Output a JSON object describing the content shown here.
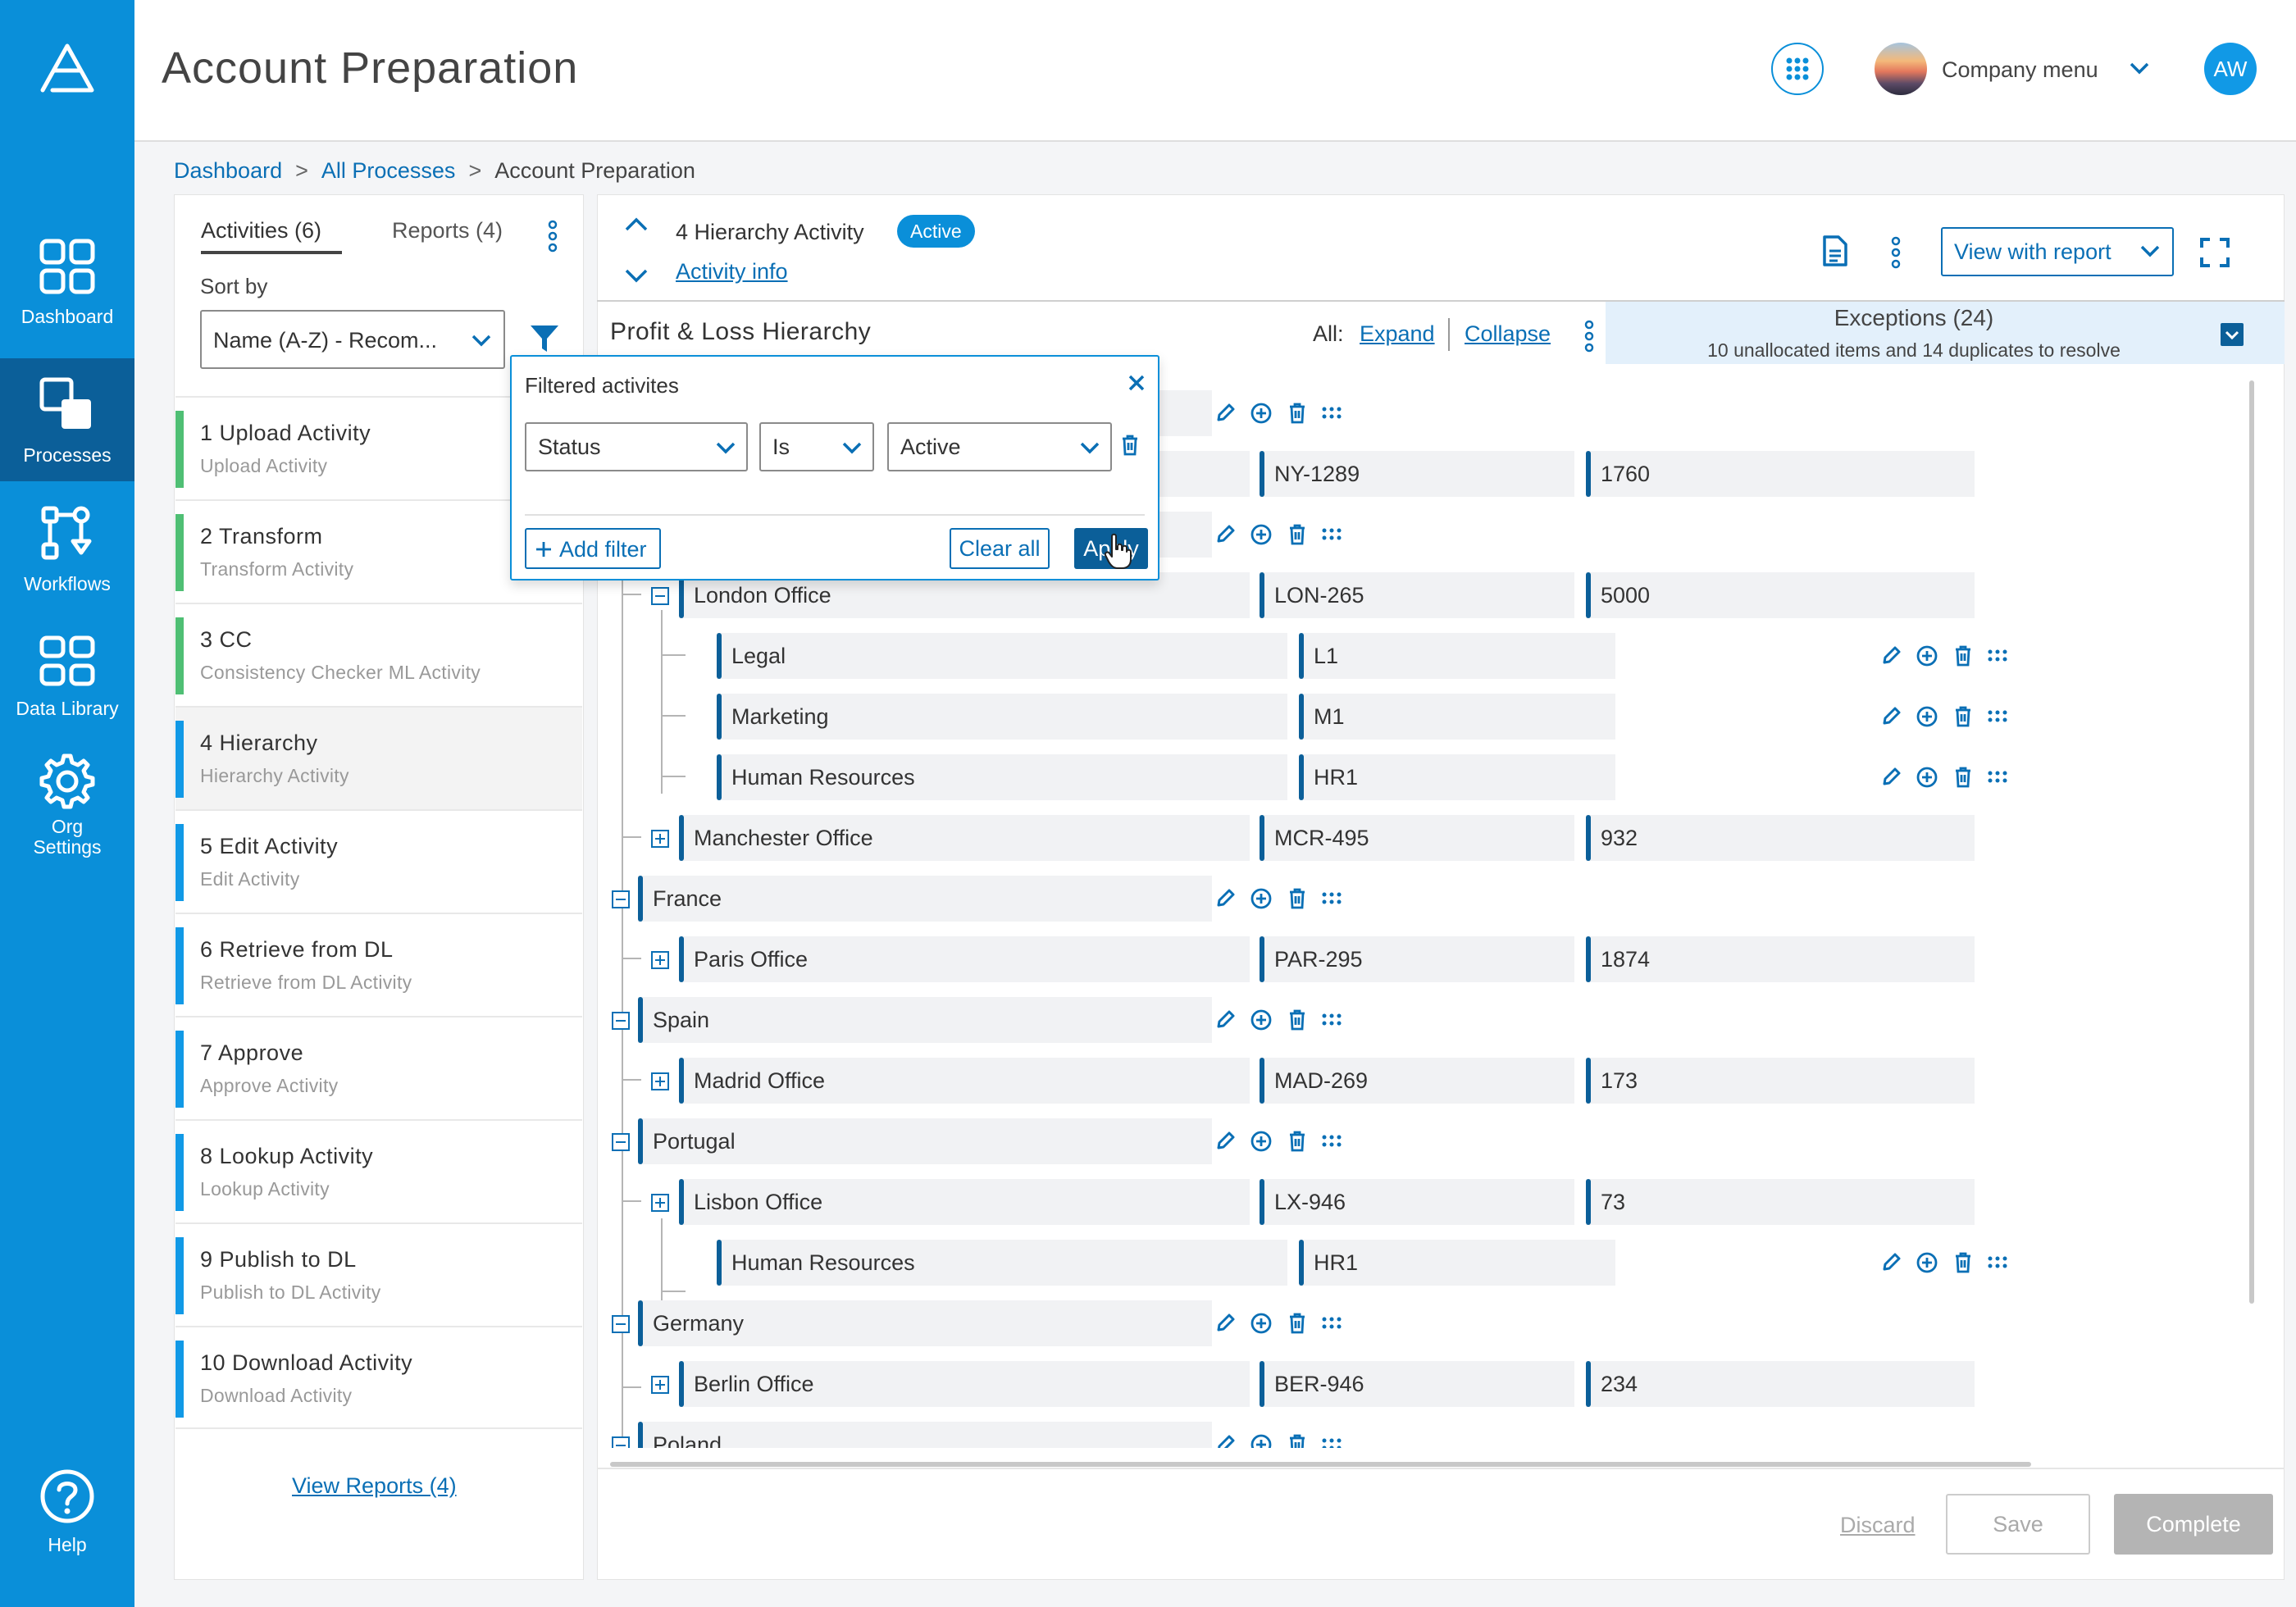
{
  "app": {
    "title": "Account Preparation"
  },
  "header": {
    "company_menu": "Company menu",
    "user_initials": "AW",
    "icons": [
      "apps-grid-icon",
      "chevron-down-icon"
    ]
  },
  "nav": {
    "items": [
      {
        "label": "Dashboard",
        "icon": "dashboard-icon"
      },
      {
        "label": "Processes",
        "icon": "processes-icon",
        "active": true
      },
      {
        "label": "Workflows",
        "icon": "workflows-icon"
      },
      {
        "label": "Data Library",
        "icon": "data-library-icon"
      },
      {
        "label": "Org",
        "label2": "Settings",
        "icon": "gear-icon"
      }
    ],
    "help": "Help"
  },
  "breadcrumb": {
    "items": [
      "Dashboard",
      "All Processes",
      "Account Preparation"
    ],
    "separator": ">"
  },
  "left_panel": {
    "tabs": [
      "Activities (6)",
      "Reports (4)"
    ],
    "sort_label": "Sort by",
    "sort_value": "Name (A-Z) - Recom...",
    "activities": [
      {
        "name": "1 Upload Activity",
        "sub": "Upload Activity",
        "color": "#4fbf74"
      },
      {
        "name": "2 Transform",
        "sub": "Transform Activity",
        "color": "#4fbf74"
      },
      {
        "name": "3 CC",
        "sub": "Consistency Checker ML Activity",
        "color": "#4fbf74"
      },
      {
        "name": "4 Hierarchy",
        "sub": "Hierarchy Activity",
        "color": "#1199e6"
      },
      {
        "name": "5 Edit Activity",
        "sub": "Edit Activity",
        "color": "#1199e6"
      },
      {
        "name": "6 Retrieve from DL",
        "sub": "Retrieve from DL Activity",
        "color": "#1199e6"
      },
      {
        "name": "7 Approve",
        "sub": "Approve Activity",
        "color": "#1199e6"
      },
      {
        "name": "8 Lookup Activity",
        "sub": "Lookup Activity",
        "color": "#1199e6"
      },
      {
        "name": "9 Publish to DL",
        "sub": "Publish to DL  Activity",
        "color": "#1199e6"
      },
      {
        "name": "10 Download Activity",
        "sub": "Download Activity",
        "color": "#1199e6"
      }
    ],
    "view_reports": "View Reports (4)"
  },
  "main": {
    "activity_title": "4 Hierarchy Activity",
    "status_badge": "Active",
    "activity_info": "Activity info",
    "view_with_report": "View with report",
    "hierarchy_title": "Profit & Loss Hierarchy",
    "all_label": "All:",
    "expand": "Expand",
    "collapse": "Collapse",
    "exceptions_title": "Exceptions (24)",
    "exceptions_sub": "10 unallocated items and 14 duplicates to resolve",
    "tree_rows": [
      {
        "name": "",
        "code": "NY-1289",
        "value": "1760"
      },
      {
        "name": "London Office",
        "code": "LON-265",
        "value": "5000"
      },
      {
        "name": "Legal",
        "code": "L1"
      },
      {
        "name": "Marketing",
        "code": "M1"
      },
      {
        "name": "Human Resources",
        "code": "HR1"
      },
      {
        "name": "Manchester Office",
        "code": "MCR-495",
        "value": "932"
      },
      {
        "name": "France"
      },
      {
        "name": "Paris Office",
        "code": "PAR-295",
        "value": "1874"
      },
      {
        "name": "Spain"
      },
      {
        "name": "Madrid Office",
        "code": "MAD-269",
        "value": "173"
      },
      {
        "name": "Portugal"
      },
      {
        "name": "Lisbon Office",
        "code": "LX-946",
        "value": "73"
      },
      {
        "name": "Human Resources",
        "code": "HR1"
      },
      {
        "name": "Germany"
      },
      {
        "name": "Berlin Office",
        "code": "BER-946",
        "value": "234"
      },
      {
        "name": "Poland"
      }
    ],
    "footer": {
      "discard": "Discard",
      "save": "Save",
      "complete": "Complete"
    }
  },
  "filter_popover": {
    "title": "Filtered activites",
    "field": "Status",
    "operator": "Is",
    "value": "Active",
    "add_filter": "Add filter",
    "clear_all": "Clear all",
    "apply": "Apply"
  },
  "colors": {
    "nav_bg": "#0a8fd9",
    "nav_active": "#0b5f99",
    "accent": "#0a6fb5",
    "complete_done": "#4fbf74"
  }
}
